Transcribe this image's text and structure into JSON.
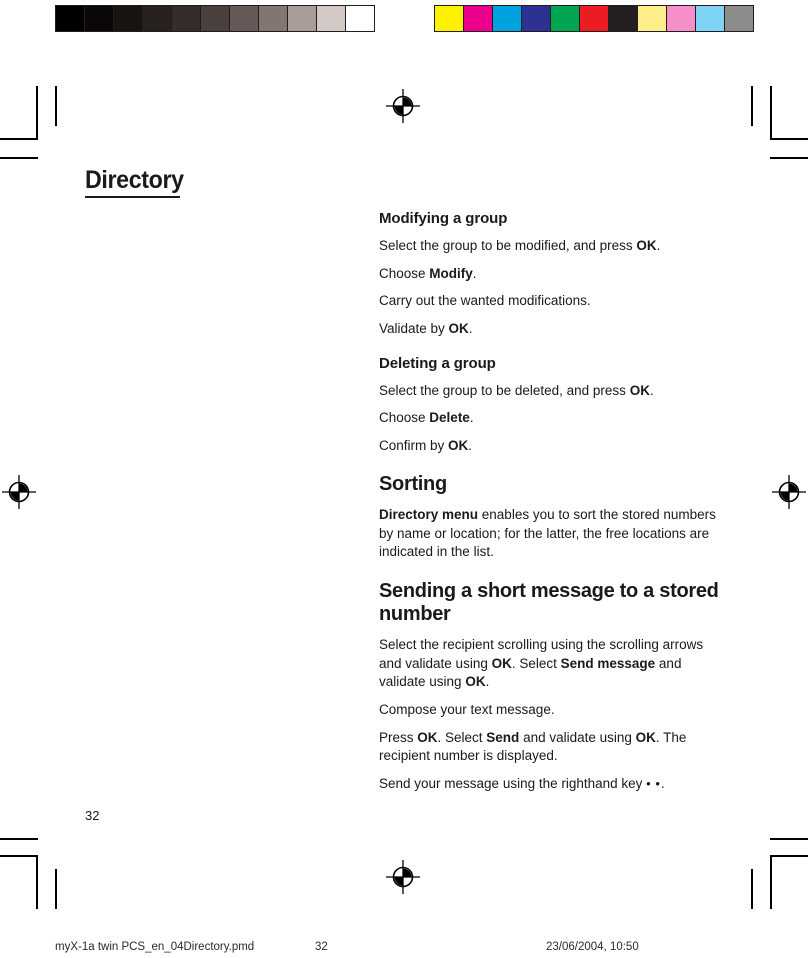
{
  "calibration": {
    "gray_bar_name": "grayscale-calibration-bar",
    "gray_swatches": [
      "#000000",
      "#0a0807",
      "#181412",
      "#272120",
      "#352d2b",
      "#4a403e",
      "#655a57",
      "#827672",
      "#a89d99",
      "#d2c8c5",
      "#ffffff"
    ],
    "color_bar_name": "color-calibration-bar",
    "color_swatches": [
      "#fff200",
      "#ec008c",
      "#00a3e0",
      "#2e3192",
      "#00a551",
      "#ed1c24",
      "#231f20",
      "#fdf08a",
      "#f58fc9",
      "#7fd4f5",
      "#8c8c8c"
    ]
  },
  "chapter": {
    "title": "Directory"
  },
  "sections": {
    "modifying": {
      "heading": "Modifying a group",
      "lines": [
        {
          "parts": [
            {
              "t": "Select the group to be modified, and press ",
              "b": false
            },
            {
              "t": "OK",
              "b": true
            },
            {
              "t": ".",
              "b": false
            }
          ]
        },
        {
          "parts": [
            {
              "t": "Choose ",
              "b": false
            },
            {
              "t": "Modify",
              "b": true
            },
            {
              "t": ".",
              "b": false
            }
          ]
        },
        {
          "parts": [
            {
              "t": "Carry out the wanted modifications.",
              "b": false
            }
          ]
        },
        {
          "parts": [
            {
              "t": "Validate by ",
              "b": false
            },
            {
              "t": "OK",
              "b": true
            },
            {
              "t": ".",
              "b": false
            }
          ]
        }
      ]
    },
    "deleting": {
      "heading": "Deleting a group",
      "lines": [
        {
          "parts": [
            {
              "t": "Select the group to be deleted, and press ",
              "b": false
            },
            {
              "t": "OK",
              "b": true
            },
            {
              "t": ".",
              "b": false
            }
          ]
        },
        {
          "parts": [
            {
              "t": "Choose ",
              "b": false
            },
            {
              "t": "Delete",
              "b": true
            },
            {
              "t": ".",
              "b": false
            }
          ]
        },
        {
          "parts": [
            {
              "t": "Confirm by ",
              "b": false
            },
            {
              "t": "OK",
              "b": true
            },
            {
              "t": ".",
              "b": false
            }
          ]
        }
      ]
    },
    "sorting": {
      "heading": "Sorting",
      "lines": [
        {
          "parts": [
            {
              "t": "Directory menu",
              "b": true
            },
            {
              "t": " enables you to sort the stored numbers by name or location; for the latter, the free locations are indicated in the list.",
              "b": false
            }
          ]
        }
      ]
    },
    "sending": {
      "heading": "Sending a short message to a stored number",
      "lines": [
        {
          "parts": [
            {
              "t": "Select the recipient scrolling using the scrolling arrows and validate using ",
              "b": false
            },
            {
              "t": "OK",
              "b": true
            },
            {
              "t": ". Select ",
              "b": false
            },
            {
              "t": "Send message",
              "b": true
            },
            {
              "t": " and validate using ",
              "b": false
            },
            {
              "t": "OK",
              "b": true
            },
            {
              "t": ".",
              "b": false
            }
          ]
        },
        {
          "parts": [
            {
              "t": "Compose your text message.",
              "b": false
            }
          ]
        },
        {
          "parts": [
            {
              "t": "Press ",
              "b": false
            },
            {
              "t": "OK",
              "b": true
            },
            {
              "t": ". Select ",
              "b": false
            },
            {
              "t": "Send",
              "b": true
            },
            {
              "t": " and validate using ",
              "b": false
            },
            {
              "t": "OK",
              "b": true
            },
            {
              "t": ". The recipient number is displayed.",
              "b": false
            }
          ]
        },
        {
          "parts": [
            {
              "t": "Send your message using the righthand key ",
              "b": false
            },
            {
              "t": "• •",
              "b": false,
              "dots": true
            },
            {
              "t": ".",
              "b": false
            }
          ]
        }
      ]
    }
  },
  "page_number": "32",
  "footer": {
    "file": "myX-1a twin PCS_en_04Directory.pmd",
    "page": "32",
    "date": "23/06/2004, 10:50"
  }
}
